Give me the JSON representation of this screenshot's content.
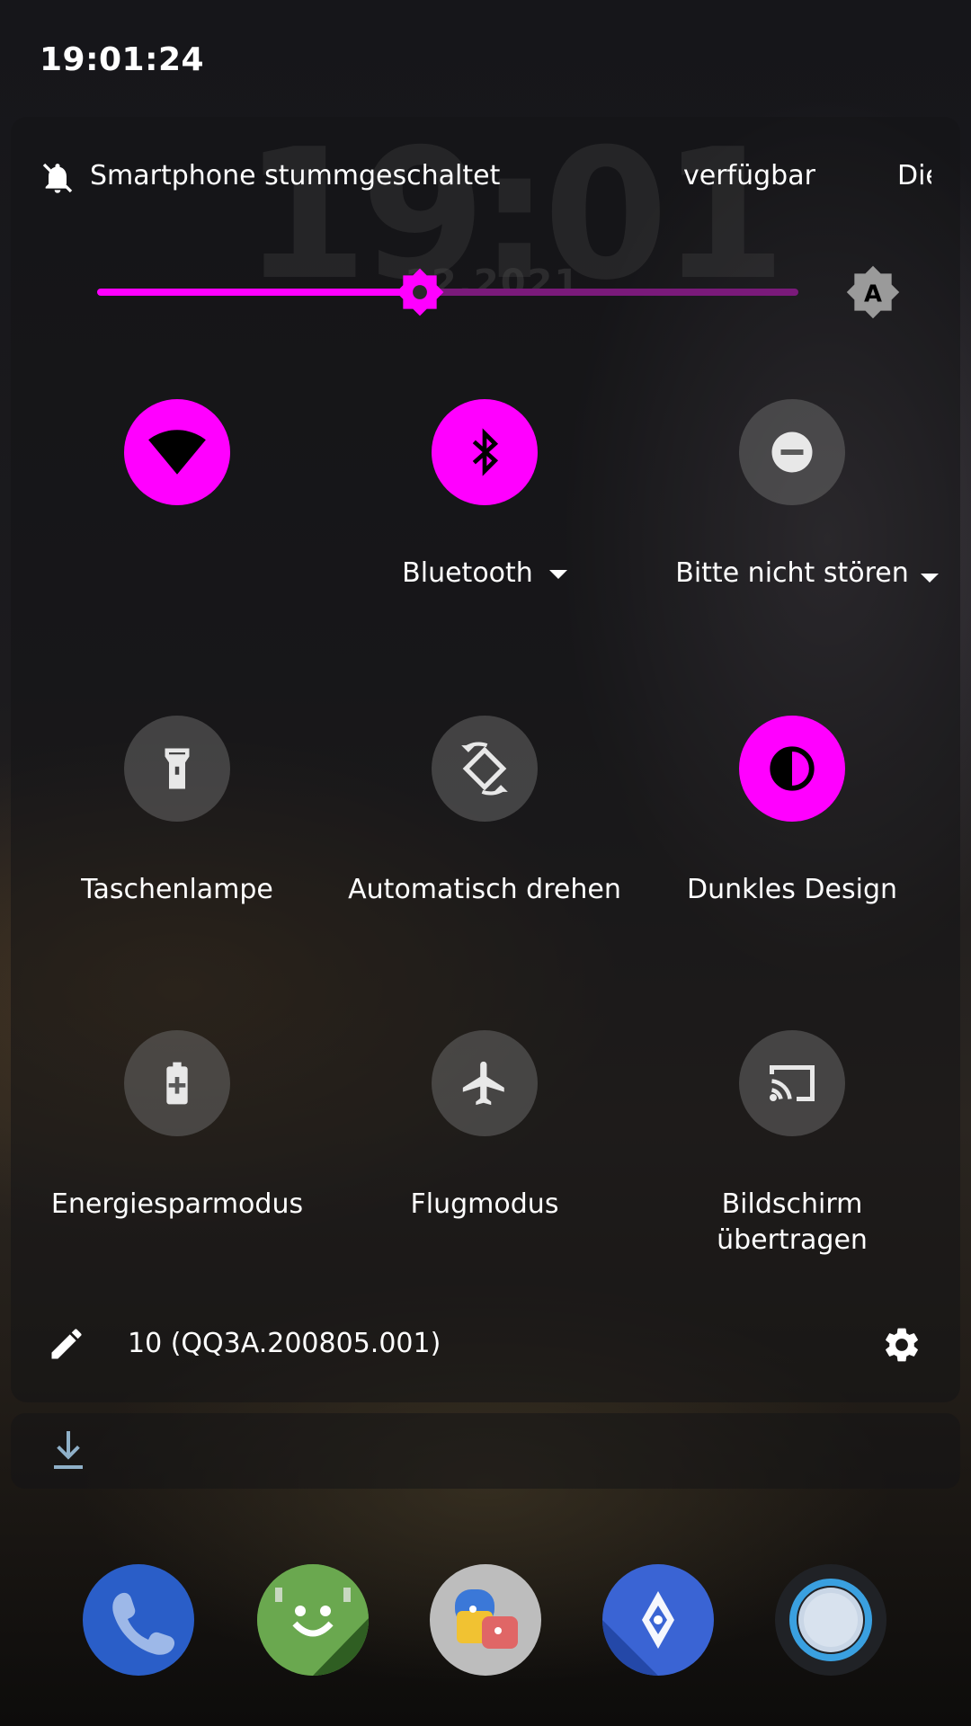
{
  "status_bar": {
    "time": "19:01:24"
  },
  "lockscreen_bg": {
    "clock": "19:01",
    "date": "12.2021"
  },
  "quick_settings": {
    "header": {
      "ringer_status": "Smartphone stummgeschaltet",
      "network_status": "verfügbar",
      "carrier_partial": "Die"
    },
    "brightness": {
      "level_percent": 46,
      "auto_label": "A"
    },
    "tiles": [
      {
        "id": "wifi",
        "label": "",
        "active": true,
        "icon": "wifi-icon"
      },
      {
        "id": "bluetooth",
        "label": "Bluetooth",
        "active": true,
        "icon": "bluetooth-icon",
        "has_dropdown": true
      },
      {
        "id": "dnd",
        "label": "Bitte nicht stören",
        "active": false,
        "icon": "do-not-disturb-icon",
        "has_dropdown": true
      },
      {
        "id": "flashlight",
        "label": "Taschenlampe",
        "active": false,
        "icon": "flashlight-icon"
      },
      {
        "id": "rotate",
        "label": "Automatisch drehen",
        "active": false,
        "icon": "auto-rotate-icon"
      },
      {
        "id": "dark",
        "label": "Dunkles Design",
        "active": true,
        "icon": "dark-theme-icon"
      },
      {
        "id": "battery",
        "label": "Energiesparmodus",
        "active": false,
        "icon": "battery-saver-icon"
      },
      {
        "id": "airplane",
        "label": "Flugmodus",
        "active": false,
        "icon": "airplane-icon"
      },
      {
        "id": "cast",
        "label": "Bildschirm übertragen",
        "active": false,
        "icon": "cast-icon"
      }
    ],
    "footer": {
      "build_number": "10 (QQ3A.200805.001)"
    }
  },
  "colors": {
    "accent": "#ff00ff",
    "tile_off": "#6e6e6e"
  },
  "dock": [
    "phone-app-icon",
    "hangouts-app-icon",
    "messages-app-icon",
    "maps-go-app-icon",
    "assistant-app-icon"
  ]
}
